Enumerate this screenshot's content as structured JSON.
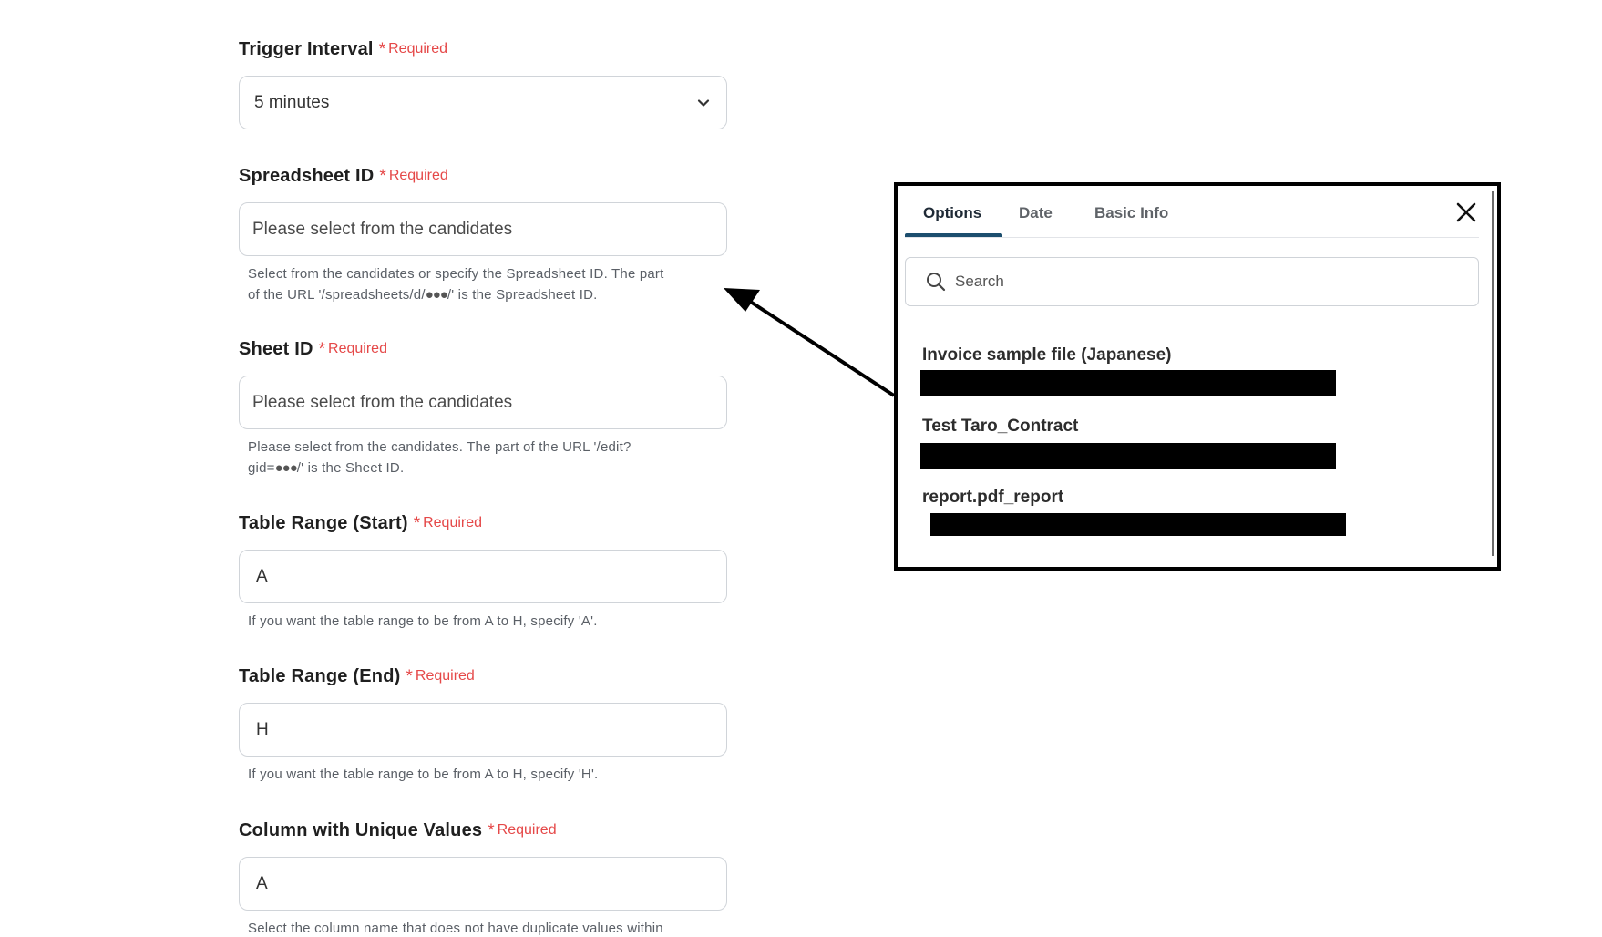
{
  "form": {
    "required_label": "Required",
    "trigger_interval": {
      "label": "Trigger Interval",
      "value": "5 minutes"
    },
    "spreadsheet_id": {
      "label": "Spreadsheet ID",
      "placeholder": "Please select from the candidates",
      "hint_line1": "Select from the candidates or specify the Spreadsheet ID. The part",
      "hint_line2_prefix": "of the URL '/spreadsheets/d/",
      "hint_dots": "●●●",
      "hint_line2_suffix": "/' is the Spreadsheet ID."
    },
    "sheet_id": {
      "label": "Sheet ID",
      "placeholder": "Please select from the candidates",
      "hint_line1": "Please select from the candidates. The part of the URL '/edit?",
      "hint_line2_prefix": "gid=",
      "hint_dots": "●●●",
      "hint_line2_suffix": "/' is the Sheet ID."
    },
    "table_range_start": {
      "label": "Table Range (Start)",
      "value": "A",
      "hint": "If you want the table range to be from A to H, specify 'A'."
    },
    "table_range_end": {
      "label": "Table Range (End)",
      "value": "H",
      "hint": "If you want the table range to be from A to H, specify 'H'."
    },
    "unique_column": {
      "label": "Column with Unique Values",
      "value": "A",
      "hint_line1": "Select the column name that does not have duplicate values within"
    }
  },
  "popup": {
    "tabs": [
      {
        "label": "Options",
        "active": true
      },
      {
        "label": "Date",
        "active": false
      },
      {
        "label": "Basic Info",
        "active": false
      }
    ],
    "search_placeholder": "Search",
    "candidates": [
      {
        "title": "Invoice sample file (Japanese)"
      },
      {
        "title": "Test Taro_Contract"
      },
      {
        "title": "report.pdf_report"
      }
    ]
  },
  "colors": {
    "required": "#e54848",
    "tab_active_underline": "#1c4e6e",
    "input_border": "#d0d4d9",
    "redaction": "#000000"
  },
  "icons": {
    "select_chevron": "chevron-down-icon",
    "search": "search-icon",
    "close": "close-icon",
    "pointer": "arrow-icon"
  }
}
